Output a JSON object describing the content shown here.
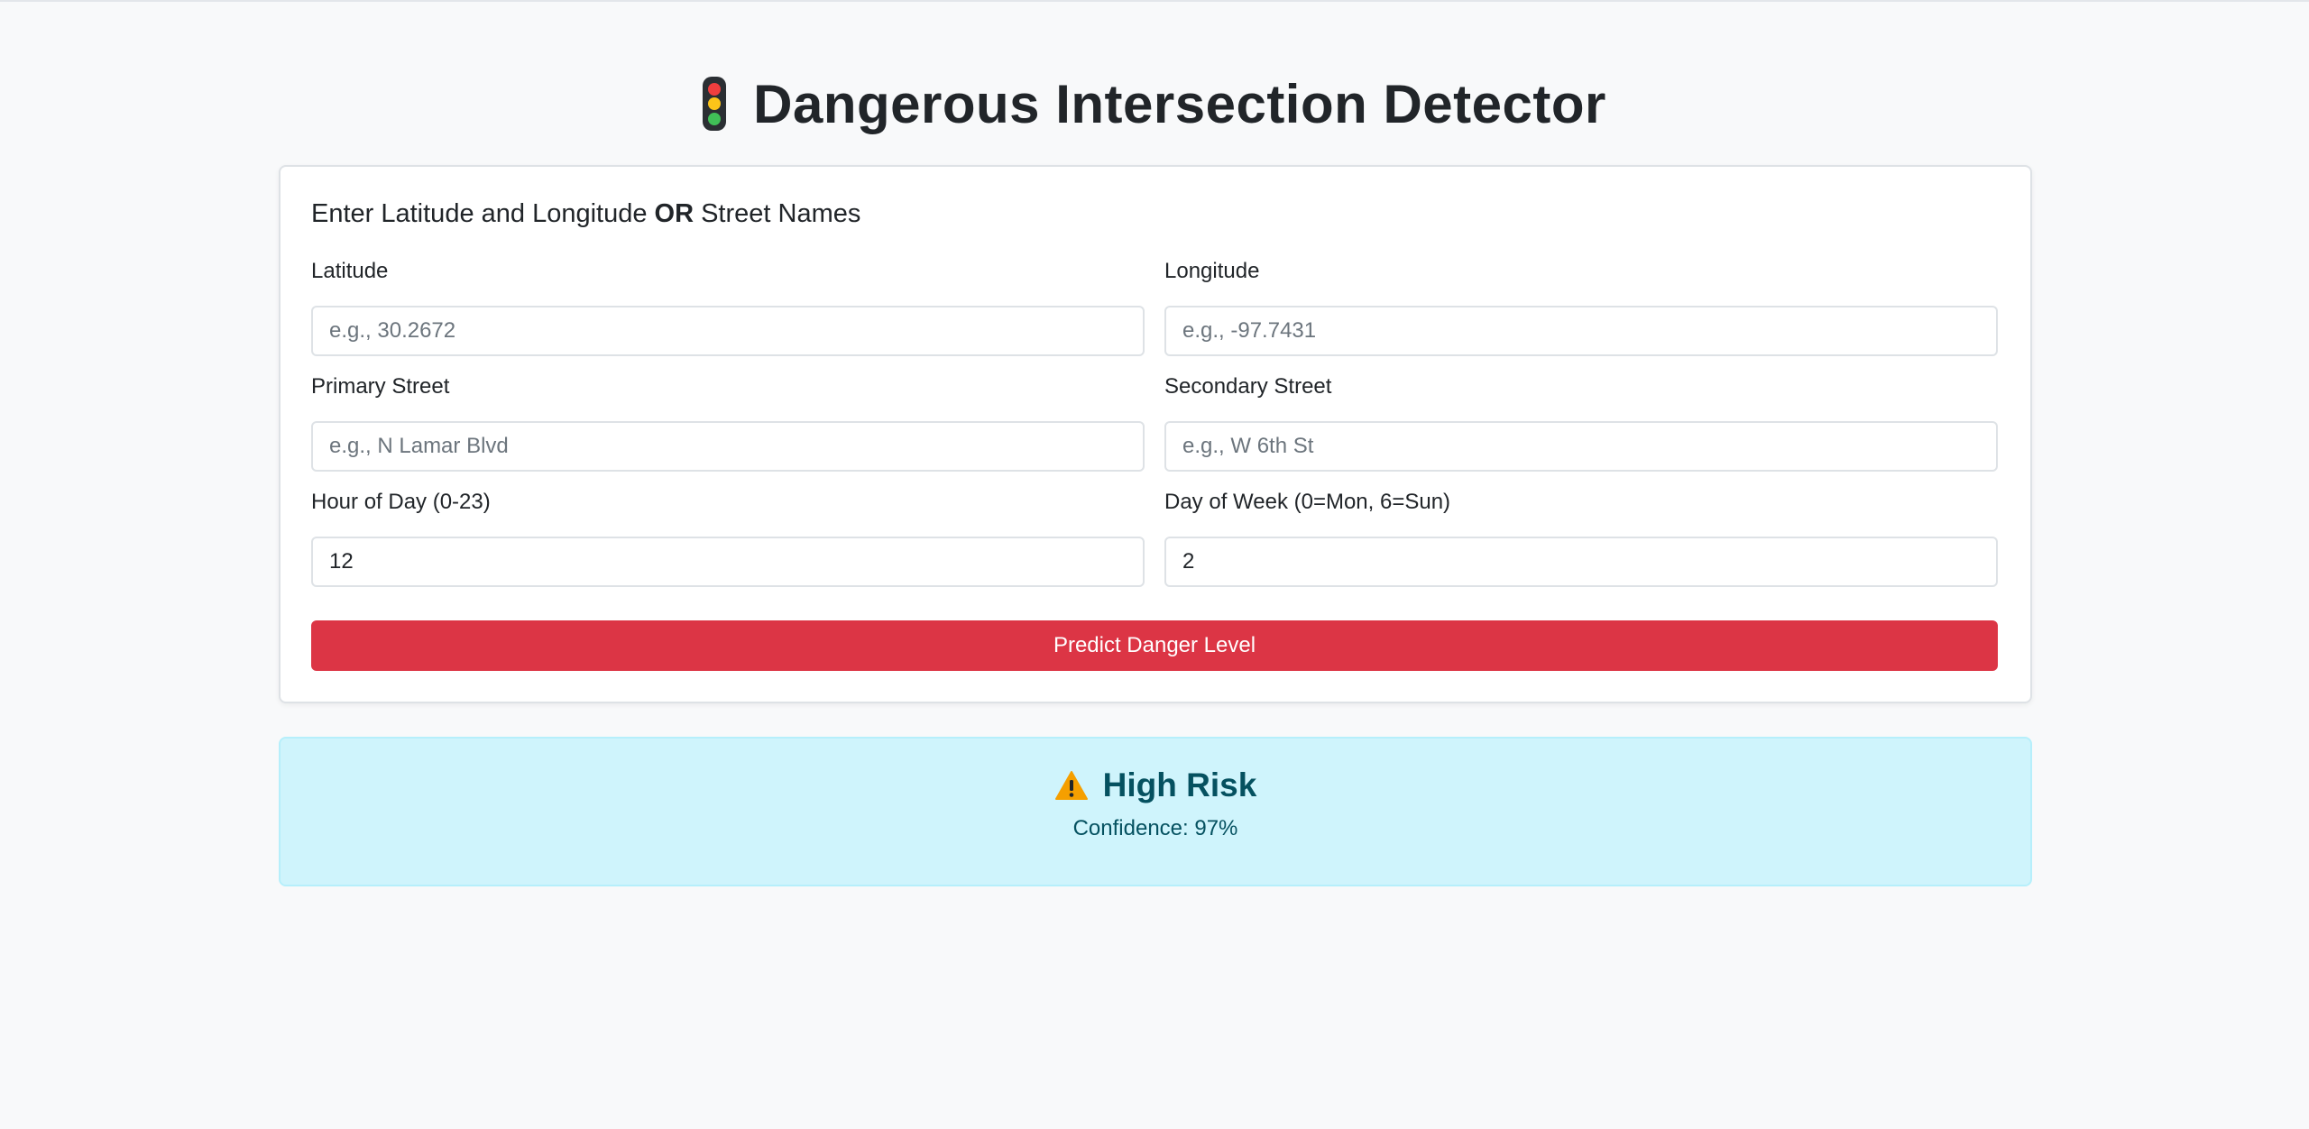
{
  "header": {
    "icon": "traffic-light-icon",
    "title": "Dangerous Intersection Detector"
  },
  "form": {
    "heading_part1": "Enter Latitude and Longitude ",
    "heading_or": "OR",
    "heading_part2": " Street Names",
    "latitude": {
      "label": "Latitude",
      "placeholder": "e.g., 30.2672",
      "value": ""
    },
    "longitude": {
      "label": "Longitude",
      "placeholder": "e.g., -97.7431",
      "value": ""
    },
    "primary_street": {
      "label": "Primary Street",
      "placeholder": "e.g., N Lamar Blvd",
      "value": ""
    },
    "secondary_street": {
      "label": "Secondary Street",
      "placeholder": "e.g., W 6th St",
      "value": ""
    },
    "hour": {
      "label": "Hour of Day (0-23)",
      "value": "12"
    },
    "day": {
      "label": "Day of Week (0=Mon, 6=Sun)",
      "value": "2"
    },
    "submit_label": "Predict Danger Level"
  },
  "result": {
    "icon": "warning-icon",
    "title": "High Risk",
    "confidence": "Confidence: 97%"
  },
  "colors": {
    "accent_button": "#dc3545",
    "result_background": "#cff4fc",
    "result_text": "#055160"
  }
}
